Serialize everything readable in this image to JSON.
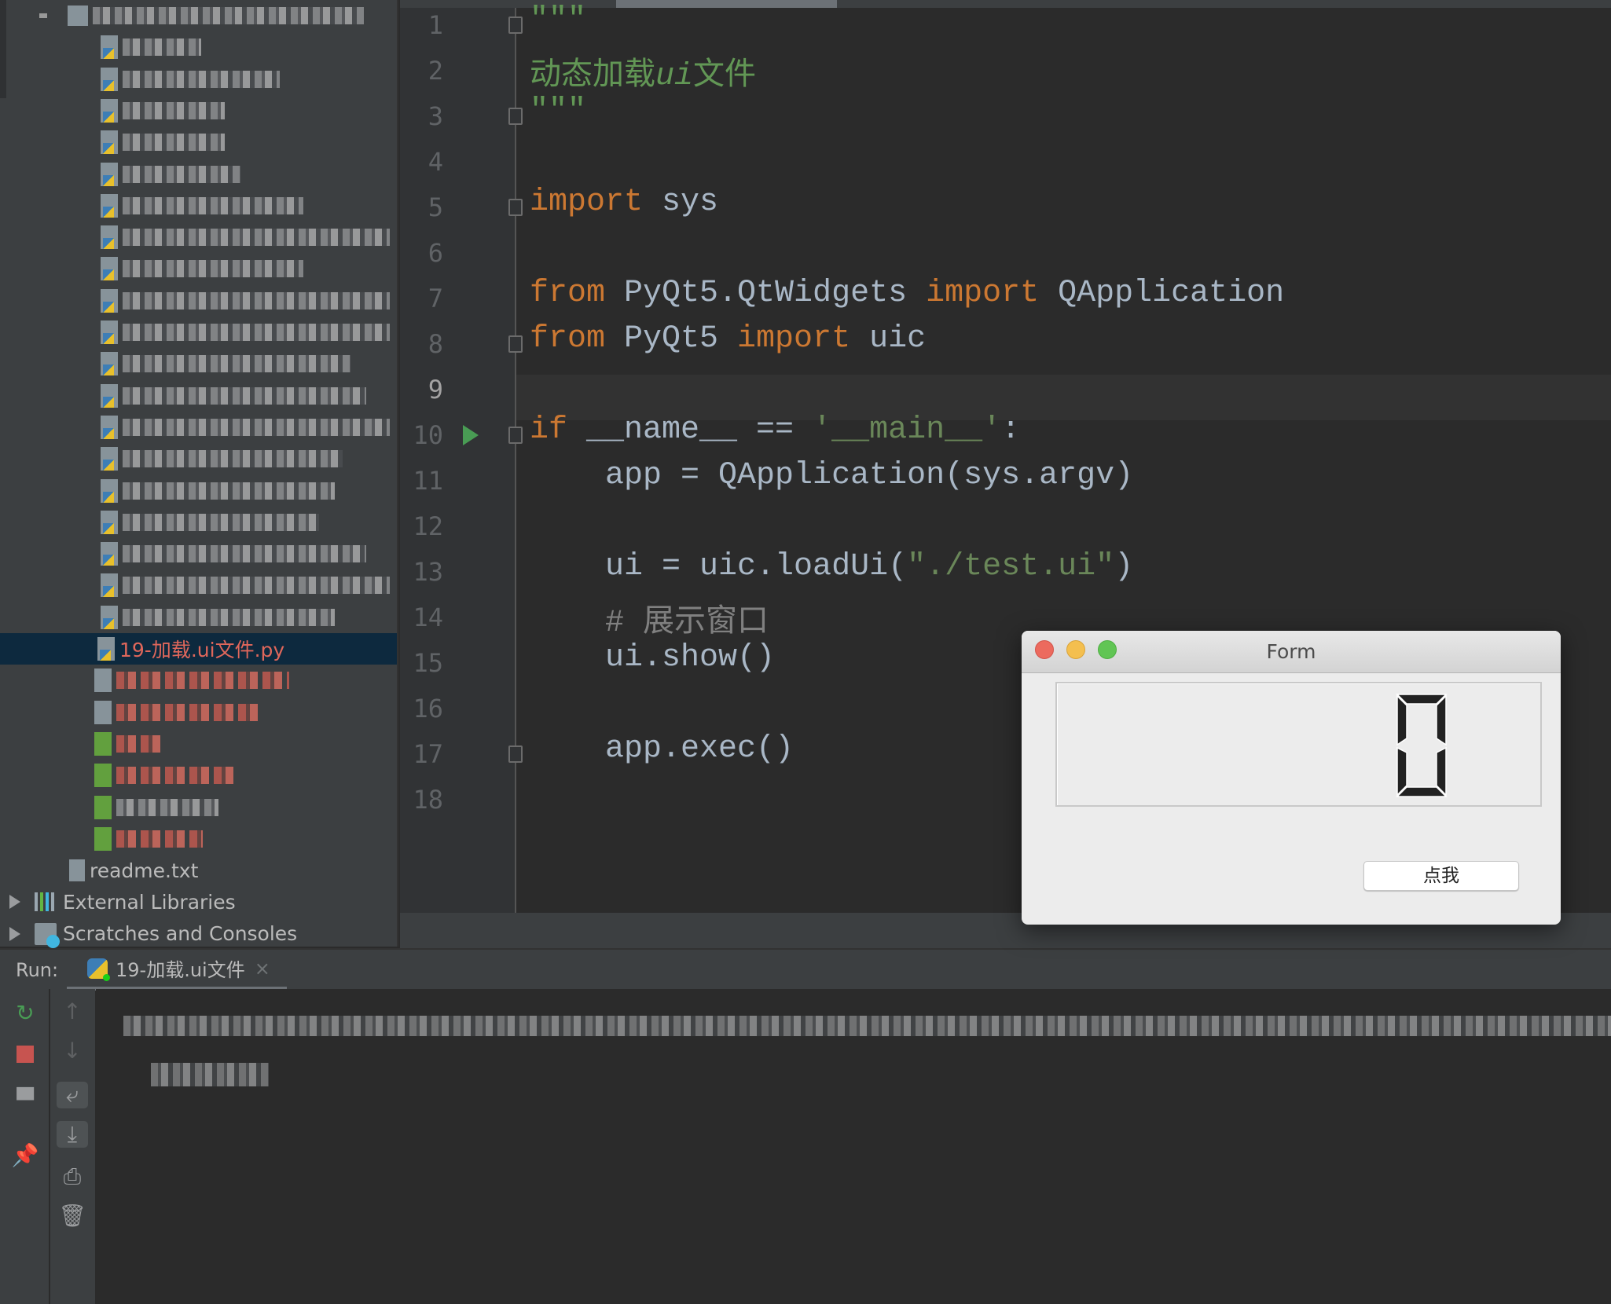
{
  "project_tree": {
    "selected_file": "19-加载.ui文件.py",
    "readme": "readme.txt",
    "external_libraries": "External Libraries",
    "scratches": "Scratches and Consoles"
  },
  "editor": {
    "current_line": 9,
    "lines": [
      {
        "n": "1",
        "tokens": [
          {
            "c": "doc",
            "s": "\"\"\""
          }
        ]
      },
      {
        "n": "2",
        "tokens": [
          {
            "c": "doc",
            "s": "动态加载"
          },
          {
            "c": "doc it",
            "s": "ui"
          },
          {
            "c": "doc",
            "s": "文件"
          }
        ]
      },
      {
        "n": "3",
        "tokens": [
          {
            "c": "doc",
            "s": "\"\"\""
          }
        ]
      },
      {
        "n": "4",
        "tokens": []
      },
      {
        "n": "5",
        "tokens": [
          {
            "c": "kw",
            "s": "import"
          },
          {
            "c": "",
            "s": " sys"
          }
        ]
      },
      {
        "n": "6",
        "tokens": []
      },
      {
        "n": "7",
        "tokens": [
          {
            "c": "kw",
            "s": "from"
          },
          {
            "c": "",
            "s": " PyQt5.QtWidgets "
          },
          {
            "c": "kw",
            "s": "import"
          },
          {
            "c": "",
            "s": " QApplication"
          }
        ]
      },
      {
        "n": "8",
        "tokens": [
          {
            "c": "kw",
            "s": "from"
          },
          {
            "c": "",
            "s": " PyQt5 "
          },
          {
            "c": "kw",
            "s": "import"
          },
          {
            "c": "",
            "s": " uic"
          }
        ]
      },
      {
        "n": "9",
        "tokens": []
      },
      {
        "n": "10",
        "tokens": [
          {
            "c": "kw",
            "s": "if"
          },
          {
            "c": "",
            "s": " __name__ == "
          },
          {
            "c": "str",
            "s": "'__main__'"
          },
          {
            "c": "",
            "s": ":"
          }
        ]
      },
      {
        "n": "11",
        "tokens": [
          {
            "c": "",
            "s": "    app = QApplication(sys.argv)"
          }
        ]
      },
      {
        "n": "12",
        "tokens": []
      },
      {
        "n": "13",
        "tokens": [
          {
            "c": "",
            "s": "    ui = uic.loadUi("
          },
          {
            "c": "str",
            "s": "\"./test.ui\""
          },
          {
            "c": "",
            "s": ")"
          }
        ]
      },
      {
        "n": "14",
        "tokens": [
          {
            "c": "cm",
            "s": "    # 展示窗口"
          }
        ]
      },
      {
        "n": "15",
        "tokens": [
          {
            "c": "",
            "s": "    ui.show()"
          }
        ]
      },
      {
        "n": "16",
        "tokens": []
      },
      {
        "n": "17",
        "tokens": [
          {
            "c": "",
            "s": "    app.exec()"
          }
        ]
      },
      {
        "n": "18",
        "tokens": []
      }
    ]
  },
  "run_panel": {
    "label": "Run:",
    "tab_label": "19-加载.ui文件",
    "close": "×"
  },
  "form_window": {
    "title": "Form",
    "lcd_value": "0",
    "button_label": "点我"
  },
  "colors": {
    "keyword": "#cc7832",
    "string": "#6a8759",
    "docstring": "#629755",
    "comment": "#808080",
    "selected_file": "#e0675b"
  }
}
